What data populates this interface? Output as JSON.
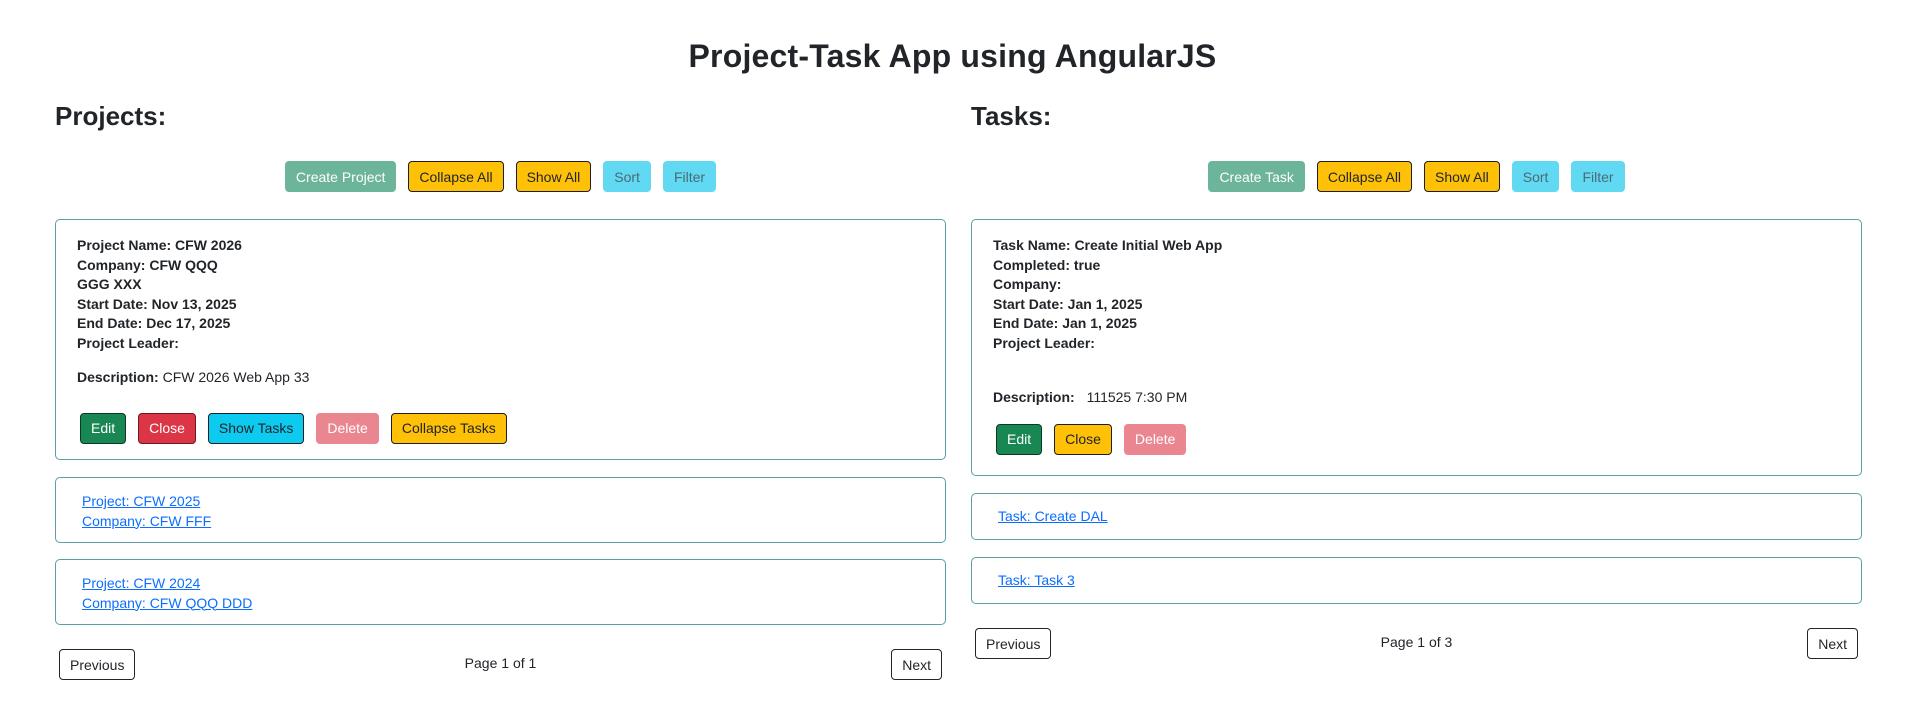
{
  "app": {
    "title": "Project-Task App using AngularJS"
  },
  "projects": {
    "heading": "Projects:",
    "toolbar": {
      "create": "Create Project",
      "collapse_all": "Collapse All",
      "show_all": "Show All",
      "sort": "Sort",
      "filter": "Filter"
    },
    "expanded": {
      "name": "Project Name: CFW 2026",
      "company": "Company: CFW QQQ",
      "company_extra": "GGG XXX",
      "start_date": "Start Date: Nov 13, 2025",
      "end_date": "End Date: Dec 17, 2025",
      "leader": "Project Leader:",
      "description_label": "Description:",
      "description_value": "CFW 2026 Web App 33",
      "buttons": {
        "edit": "Edit",
        "close": "Close",
        "show_tasks": "Show Tasks",
        "delete": "Delete",
        "collapse_tasks": "Collapse Tasks"
      }
    },
    "collapsed": [
      {
        "project": "Project: CFW 2025",
        "company": "Company: CFW FFF"
      },
      {
        "project": "Project: CFW 2024",
        "company": "Company: CFW QQQ DDD"
      }
    ],
    "pager": {
      "previous": "Previous",
      "page_label": "Page",
      "page": "1",
      "of_label": "of",
      "total": "1",
      "next": "Next"
    }
  },
  "tasks": {
    "heading": "Tasks:",
    "toolbar": {
      "create": "Create Task",
      "collapse_all": "Collapse All",
      "show_all": "Show All",
      "sort": "Sort",
      "filter": "Filter"
    },
    "expanded": {
      "name": "Task Name: Create Initial Web App",
      "completed": "Completed: true",
      "company": "Company:",
      "start_date": "Start Date: Jan 1, 2025",
      "end_date": "End Date: Jan 1, 2025",
      "leader": "Project Leader:",
      "description_label": "Description:",
      "description_value": "111525 7:30 PM",
      "buttons": {
        "edit": "Edit",
        "close": "Close",
        "delete": "Delete"
      }
    },
    "collapsed": [
      {
        "task": "Task: Create DAL"
      },
      {
        "task": "Task: Task 3"
      }
    ],
    "pager": {
      "previous": "Previous",
      "page_label": "Page",
      "page": "1",
      "of_label": "of",
      "total": "3",
      "next": "Next"
    }
  },
  "colors": {
    "card_border": "#5a9fa8",
    "link": "#0d6efd",
    "success": "#198754",
    "danger": "#dc3545",
    "warning": "#ffc107",
    "info": "#0dcaf0"
  }
}
